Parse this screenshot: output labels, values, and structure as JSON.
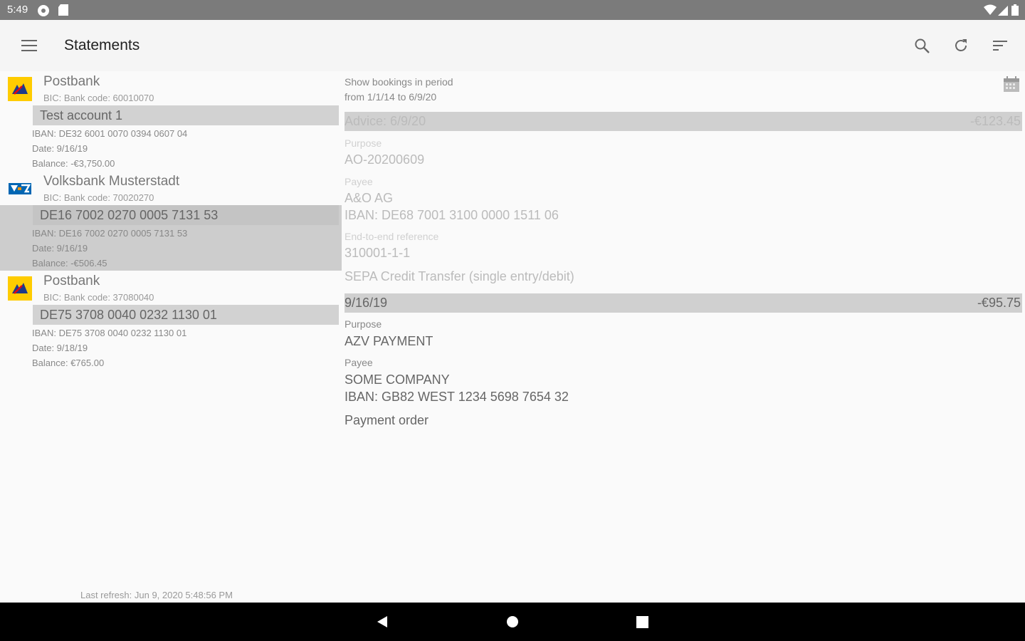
{
  "status_bar": {
    "time": "5:49"
  },
  "app_bar": {
    "title": "Statements",
    "icons": [
      "menu-icon",
      "search-icon",
      "refresh-icon",
      "sort-icon"
    ]
  },
  "accounts": [
    {
      "bank_name": "Postbank",
      "bic": "BIC: Bank code: 60010070",
      "account_name": "Test account 1",
      "iban": "IBAN: DE32 6001 0070 0394 0607 04",
      "date": "Date: 9/16/19",
      "balance": "Balance: -€3,750.00",
      "selected": false
    },
    {
      "bank_name": "Volksbank Musterstadt",
      "bic": "BIC: Bank code: 70020270",
      "account_name": "DE16 7002 0270 0005 7131 53",
      "iban": "IBAN: DE16 7002 0270 0005 7131 53",
      "date": "Date: 9/16/19",
      "balance": "Balance: -€506.45",
      "selected": true
    },
    {
      "bank_name": "Postbank",
      "bic": "BIC: Bank code: 37080040",
      "account_name": "DE75 3708 0040 0232 1130 01",
      "iban": "IBAN: DE75 3708 0040 0232 1130 01",
      "date": "Date: 9/18/19",
      "balance": "Balance: €765.00",
      "selected": false
    }
  ],
  "last_refresh": "Last refresh: Jun 9, 2020 5:48:56 PM",
  "period": {
    "line1": "Show bookings in period",
    "line2": "from 1/1/14 to 6/9/20"
  },
  "bookings": [
    {
      "header": "Advice: 6/9/20",
      "amount": "-€123.45",
      "purpose_label": "Purpose",
      "purpose": "AO-20200609",
      "payee_label": "Payee",
      "payee": "A&O AG",
      "payee_iban": "IBAN: DE68 7001 3100 0000 1511 06",
      "e2e_label": "End-to-end reference",
      "e2e": "310001-1-1",
      "type": "SEPA Credit Transfer (single entry/debit)"
    },
    {
      "header": "9/16/19",
      "amount": "-€95.75",
      "purpose_label": "Purpose",
      "purpose": "AZV PAYMENT",
      "payee_label": "Payee",
      "payee": "SOME COMPANY",
      "payee_iban": "IBAN: GB82 WEST 1234 5698 7654 32",
      "type": "Payment order"
    }
  ]
}
